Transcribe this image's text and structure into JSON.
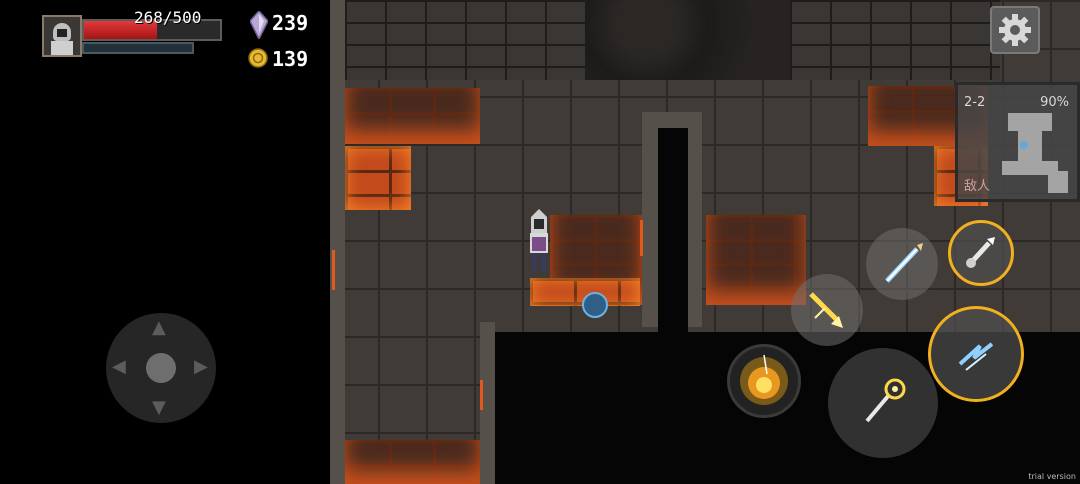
{
  "hud": {
    "hp_text": "268/500",
    "hp_fraction": 0.536,
    "crystals": "239",
    "coins": "139"
  },
  "minimap": {
    "level": "2-2",
    "explored": "90%",
    "enemy_label": "敌人"
  },
  "watermark": "trial version",
  "colors": {
    "hp": "#d42a2a",
    "crystal": "#b8a6d8",
    "coin": "#e8b830",
    "skill_ring": "#f0b020"
  },
  "icons": {
    "settings": "gear-icon",
    "move": "joystick",
    "skills": [
      "ice-spear-icon",
      "sword-slash-icon",
      "fire-burst-icon",
      "magic-staff-icon",
      "dash-icon",
      "lightning-icon"
    ]
  }
}
